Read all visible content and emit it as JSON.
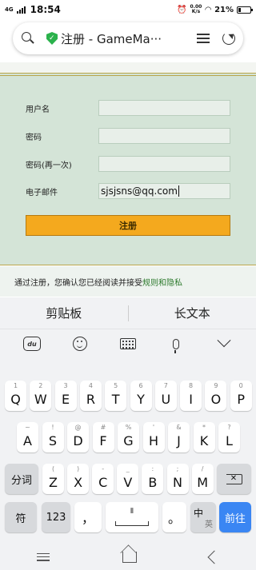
{
  "status_bar": {
    "network": "4G",
    "time": "18:54",
    "speed_value": "0.00",
    "speed_unit": "K/s",
    "battery": "21%",
    "battery_level": 0.21
  },
  "url_bar": {
    "title": "注册 - GameMa···"
  },
  "form": {
    "username_label": "用户名",
    "username_value": "",
    "password_label": "密码",
    "password_value": "",
    "password2_label": "密码(再一次)",
    "password2_value": "",
    "email_label": "电子邮件",
    "email_value": "sjsjsns@qq.com",
    "submit_label": "注册"
  },
  "terms": {
    "text": "通过注册，您确认您已经阅读并接受",
    "link": "规则和隐私"
  },
  "keyboard": {
    "clipboard": "剪贴板",
    "long_text": "长文本",
    "row1": [
      {
        "k": "Q",
        "h": "1"
      },
      {
        "k": "W",
        "h": "2"
      },
      {
        "k": "E",
        "h": "3"
      },
      {
        "k": "R",
        "h": "4"
      },
      {
        "k": "T",
        "h": "5"
      },
      {
        "k": "Y",
        "h": "6"
      },
      {
        "k": "U",
        "h": "7"
      },
      {
        "k": "I",
        "h": "8"
      },
      {
        "k": "O",
        "h": "9"
      },
      {
        "k": "P",
        "h": "0"
      }
    ],
    "row2": [
      {
        "k": "A",
        "h": "~"
      },
      {
        "k": "S",
        "h": "!"
      },
      {
        "k": "D",
        "h": "@"
      },
      {
        "k": "F",
        "h": "#"
      },
      {
        "k": "G",
        "h": "%"
      },
      {
        "k": "H",
        "h": "'"
      },
      {
        "k": "J",
        "h": "&"
      },
      {
        "k": "K",
        "h": "*"
      },
      {
        "k": "L",
        "h": "?"
      }
    ],
    "row3": [
      {
        "k": "Z",
        "h": "("
      },
      {
        "k": "X",
        "h": ")"
      },
      {
        "k": "C",
        "h": "-"
      },
      {
        "k": "V",
        "h": "_"
      },
      {
        "k": "B",
        "h": ":"
      },
      {
        "k": "N",
        "h": ";"
      },
      {
        "k": "M",
        "h": "/"
      }
    ],
    "fenci": "分词",
    "fu": "符",
    "num": "123",
    "comma": "，",
    "period": "。",
    "lang_zh": "中",
    "lang_en": "英",
    "go": "前往"
  }
}
